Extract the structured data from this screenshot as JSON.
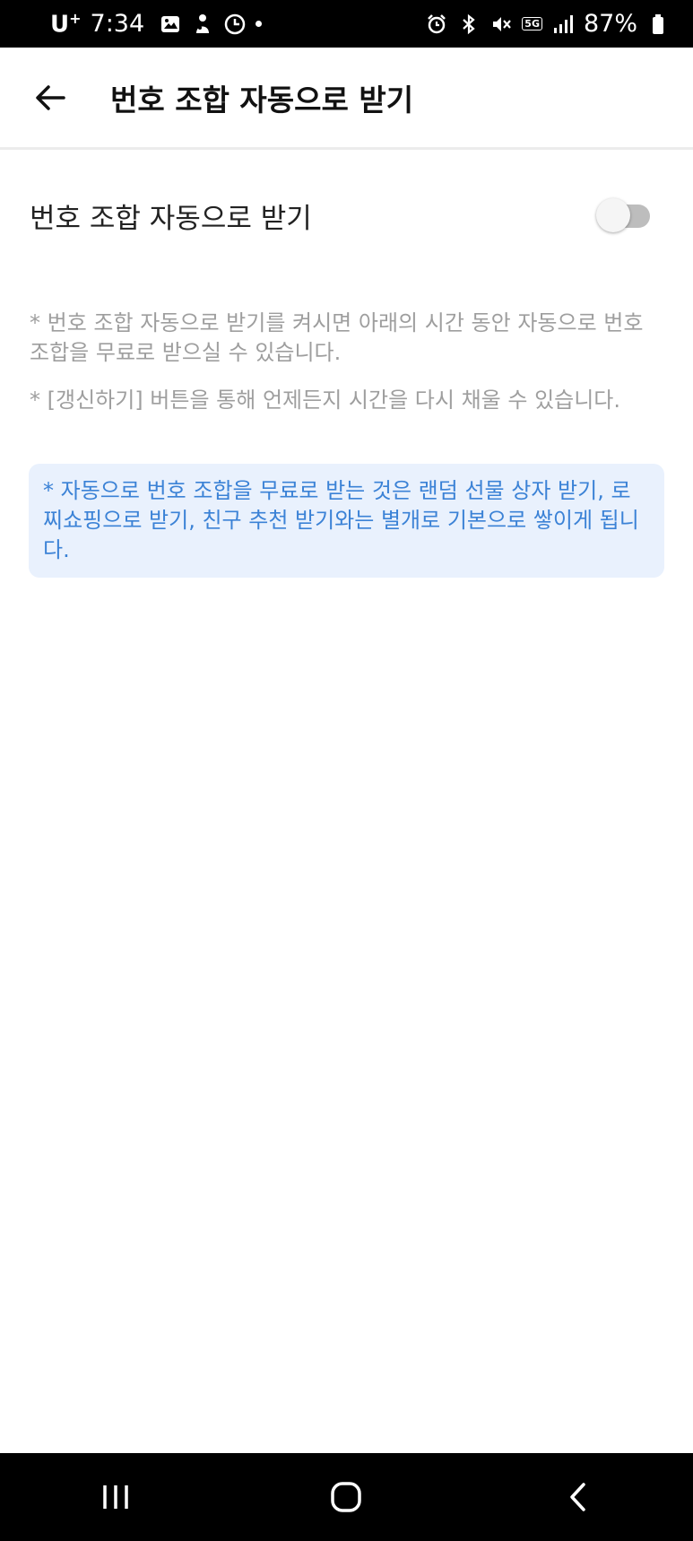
{
  "status_bar": {
    "carrier": "U",
    "carrier_sup": "+",
    "time": "7:34",
    "network": "5G",
    "battery": "87%"
  },
  "app_bar": {
    "title": "번호 조합 자동으로 받기"
  },
  "setting": {
    "label": "번호 조합 자동으로 받기",
    "enabled": false
  },
  "notes": [
    "* 번호 조합 자동으로 받기를 켜시면 아래의 시간 동안 자동으로 번호 조합을 무료로 받으실 수 있습니다.",
    "* [갱신하기] 버튼을 통해 언제든지 시간을 다시 채울 수 있습니다."
  ],
  "info_box": {
    "text": "* 자동으로 번호 조합을 무료로 받는 것은 랜덤 선물 상자 받기, 로찌쇼핑으로 받기, 친구 추천 받기와는 별개로 기본으로 쌓이게 됩니다."
  },
  "colors": {
    "info_text": "#3b82d6",
    "info_background": "#e9f1fd",
    "note_text": "#9e9e9e"
  }
}
